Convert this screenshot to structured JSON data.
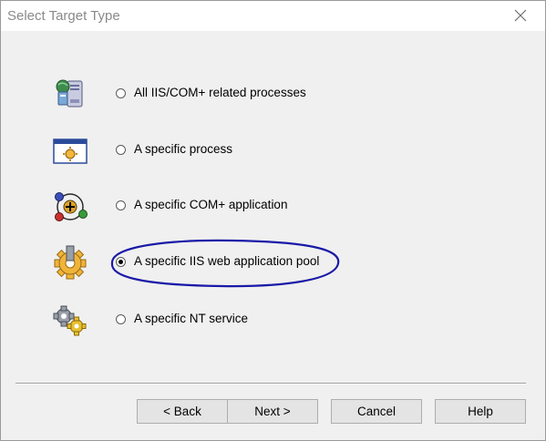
{
  "window": {
    "title": "Select Target Type",
    "close_icon": "close-icon"
  },
  "options": [
    {
      "label": "All IIS/COM+ related processes",
      "icon": "iis-server-icon",
      "selected": false
    },
    {
      "label": "A specific process",
      "icon": "process-window-icon",
      "selected": false
    },
    {
      "label": "A specific COM+ application",
      "icon": "com-plus-icon",
      "selected": false
    },
    {
      "label": "A specific IIS web application pool",
      "icon": "app-pool-gear-icon",
      "selected": true
    },
    {
      "label": "A specific NT service",
      "icon": "nt-service-gears-icon",
      "selected": false
    }
  ],
  "buttons": {
    "back": "< Back",
    "next": "Next >",
    "cancel": "Cancel",
    "help": "Help"
  },
  "annotation": {
    "color": "#1a1aa8"
  }
}
